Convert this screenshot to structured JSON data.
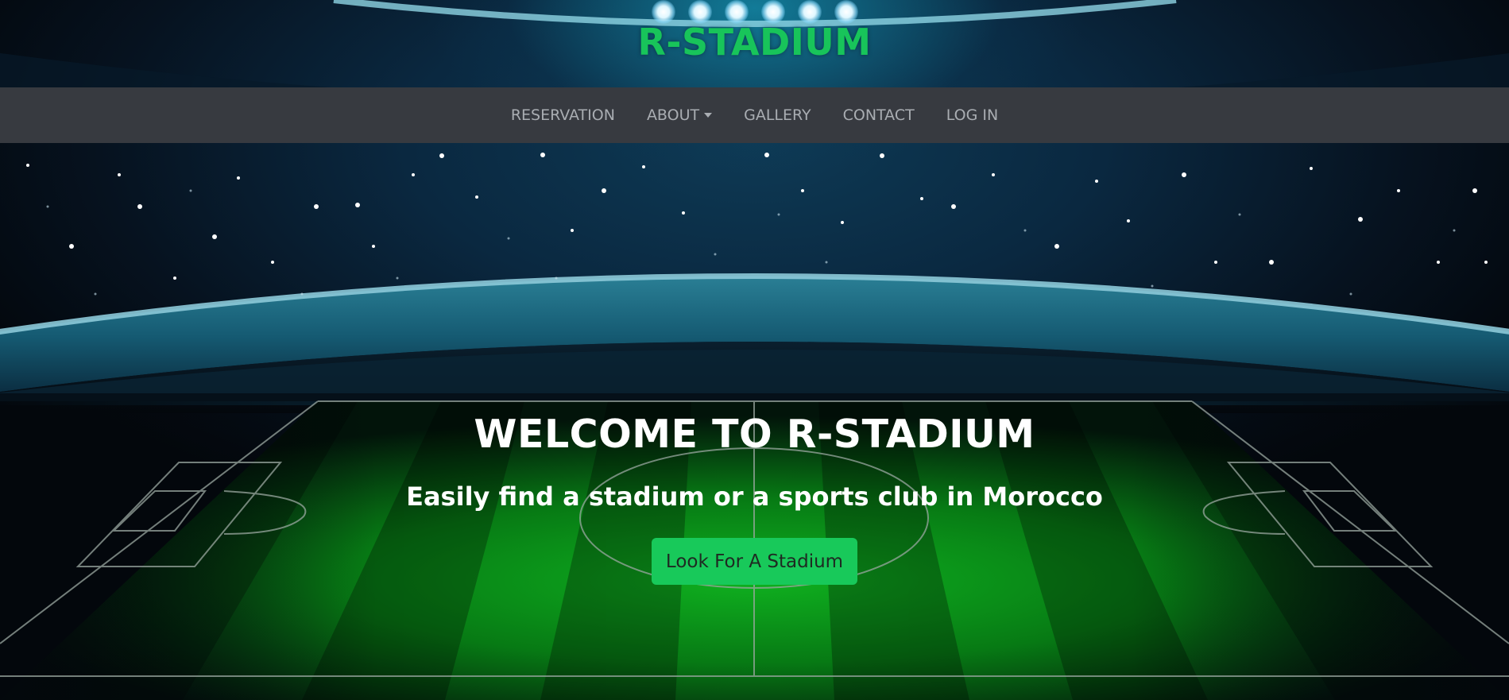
{
  "brand": {
    "name": "R-STADIUM",
    "color": "#18c45a"
  },
  "nav": {
    "items": [
      {
        "label": "RESERVATION"
      },
      {
        "label": "ABOUT",
        "dropdown": true
      },
      {
        "label": "GALLERY"
      },
      {
        "label": "CONTACT"
      },
      {
        "label": "LOG IN"
      }
    ],
    "background": "#373a40"
  },
  "hero": {
    "title": "WELCOME TO R-STADIUM",
    "subtitle": "Easily find a stadium or a sports club in Morocco",
    "cta_label": "Look For A Stadium",
    "cta_color": "#18c95a"
  }
}
